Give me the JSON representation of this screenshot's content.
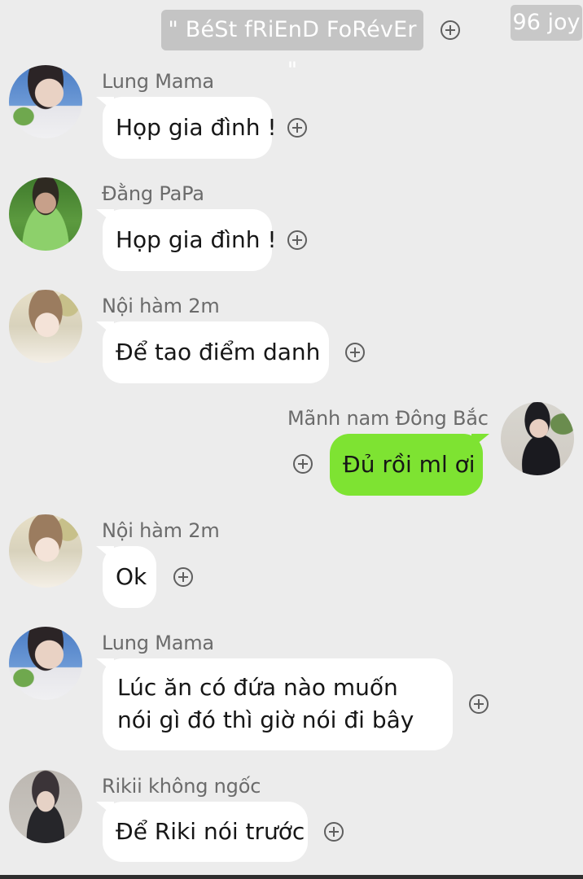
{
  "header": {
    "group_name": "\" BéSt fRiEnD FoRévEr \"",
    "watermark": "96 joy"
  },
  "messages": [
    {
      "sender": "Lung Mama",
      "text": "Họp gia đình !",
      "direction": "incoming",
      "avatar": "lung-mama-avatar"
    },
    {
      "sender": "Đằng PaPa",
      "text": "Họp gia đình !",
      "direction": "incoming",
      "avatar": "dang-papa-avatar"
    },
    {
      "sender": "Nội hàm 2m",
      "text": "Để tao điểm danh",
      "direction": "incoming",
      "avatar": "noi-ham-avatar"
    },
    {
      "sender": "Mãnh nam Đông Bắc",
      "text": "Đủ rồi ml ơi",
      "direction": "outgoing",
      "avatar": "manh-nam-avatar"
    },
    {
      "sender": "Nội hàm 2m",
      "text": "Ok",
      "direction": "incoming",
      "avatar": "noi-ham-avatar"
    },
    {
      "sender": "Lung Mama",
      "text": "Lúc ăn có đứa nào muốn nói gì đó thì giờ nói đi bây",
      "direction": "incoming",
      "avatar": "lung-mama-avatar"
    },
    {
      "sender": "Rikii không ngốc",
      "text": "Để Riki nói trước",
      "direction": "incoming",
      "avatar": "rikii-avatar"
    }
  ],
  "colors": {
    "background": "#ececec",
    "incoming_bubble": "#ffffff",
    "outgoing_bubble": "#7ee332",
    "header_pill": "#c4c4c4"
  },
  "icons": {
    "add": "plus-circle-icon"
  }
}
